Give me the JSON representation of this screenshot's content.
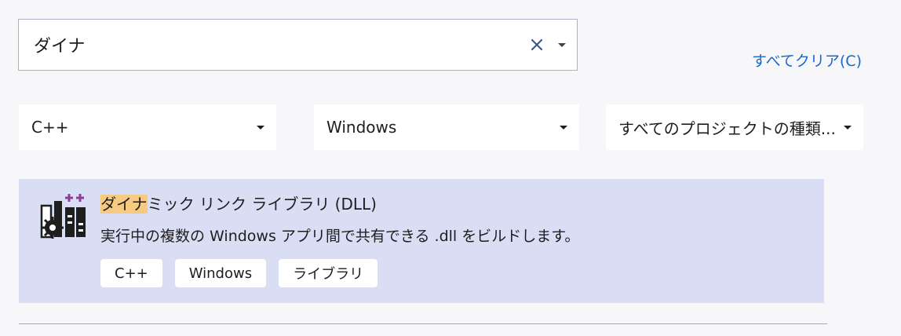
{
  "search": {
    "value": "ダイナ",
    "clear_icon": "close-icon",
    "dropdown_icon": "caret-down-icon"
  },
  "clear_all": {
    "label": "すべてクリア(C)"
  },
  "filters": {
    "language": {
      "label": "C++"
    },
    "platform": {
      "label": "Windows"
    },
    "project_type": {
      "label": "すべてのプロジェクトの種類..."
    }
  },
  "results": [
    {
      "title_highlight": "ダイナ",
      "title_rest": "ミック リンク ライブラリ (DLL)",
      "description": "実行中の複数の Windows アプリ間で共有できる .dll をビルドします。",
      "icon": "dll-library-icon",
      "tags": [
        "C++",
        "Windows",
        "ライブラリ"
      ]
    }
  ],
  "colors": {
    "background": "#f7f7fa",
    "link": "#1a66c9",
    "selected_row": "#d9def5",
    "highlight": "#f6cb81",
    "icon_accent": "#8e3f93"
  }
}
